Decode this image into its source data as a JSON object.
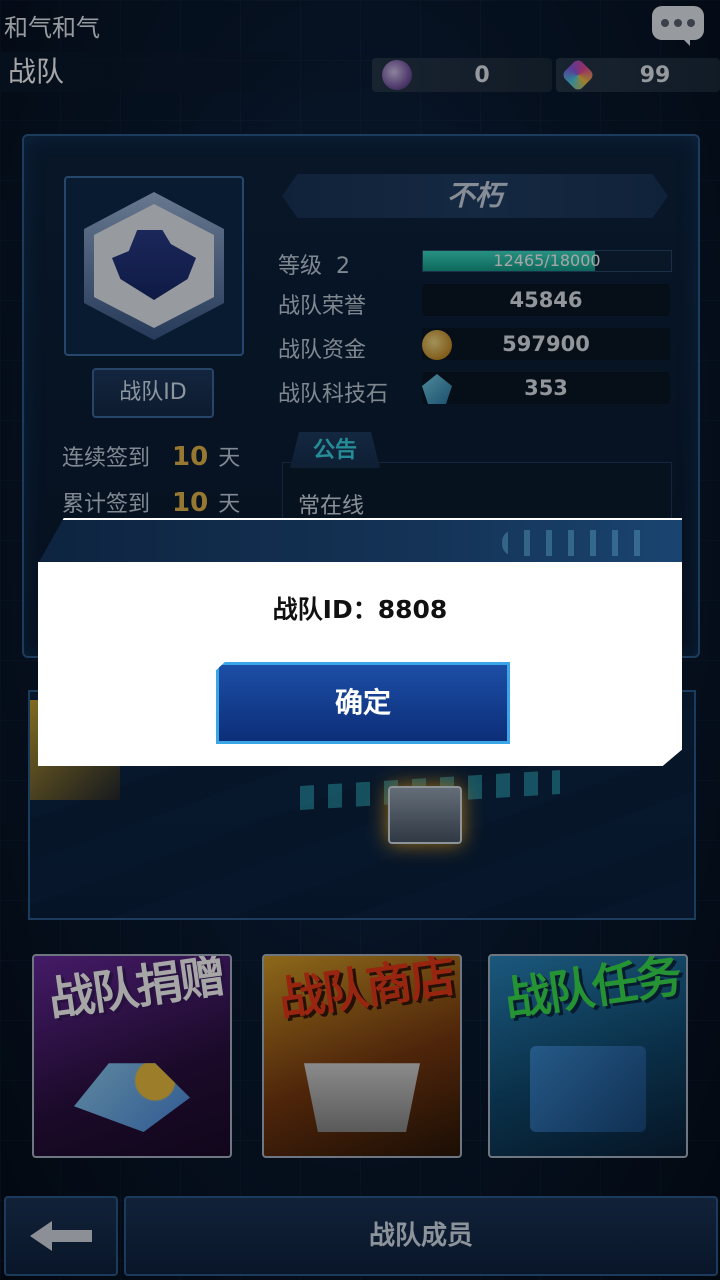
{
  "header": {
    "player_name": "和气和气",
    "screen_title": "战队",
    "currencies": [
      {
        "icon": "orb-icon",
        "value": "0"
      },
      {
        "icon": "gem-icon",
        "value": "99"
      }
    ]
  },
  "team": {
    "name": "不朽",
    "id_button": "战队ID",
    "level_label": "等级",
    "level": "2",
    "exp_text": "12465/18000",
    "exp_fraction": 0.6925,
    "honor_label": "战队荣誉",
    "honor": "45846",
    "funds_label": "战队资金",
    "funds": "597900",
    "tech_label": "战队科技石",
    "tech": "353",
    "signin": [
      {
        "label": "连续签到",
        "value": "10",
        "unit": "天"
      },
      {
        "label": "累计签到",
        "value": "10",
        "unit": "天"
      }
    ],
    "notice_tab": "公告",
    "notice_text": "常在线"
  },
  "cards": [
    {
      "title": "战队捐赠"
    },
    {
      "title": "战队商店"
    },
    {
      "title": "战队任务"
    }
  ],
  "bottom": {
    "members_label": "战队成员"
  },
  "dialog": {
    "message": "战队ID：8808",
    "ok_label": "确定"
  }
}
